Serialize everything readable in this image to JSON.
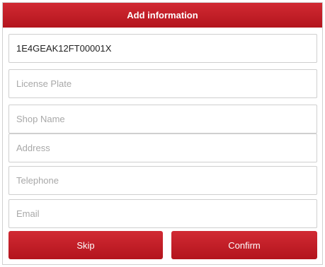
{
  "dialog": {
    "title": "Add information"
  },
  "fields": {
    "vin": {
      "value": "1E4GEAK12FT00001X",
      "placeholder": ""
    },
    "license_plate": {
      "value": "",
      "placeholder": "License Plate"
    },
    "shop_name": {
      "value": "",
      "placeholder": "Shop Name"
    },
    "address": {
      "value": "",
      "placeholder": "Address"
    },
    "telephone": {
      "value": "",
      "placeholder": "Telephone"
    },
    "email": {
      "value": "",
      "placeholder": "Email"
    }
  },
  "actions": {
    "skip_label": "Skip",
    "confirm_label": "Confirm"
  },
  "colors": {
    "accent": "#c21f28",
    "field_border": "#cfcfcf",
    "placeholder": "#a8a8a8"
  }
}
